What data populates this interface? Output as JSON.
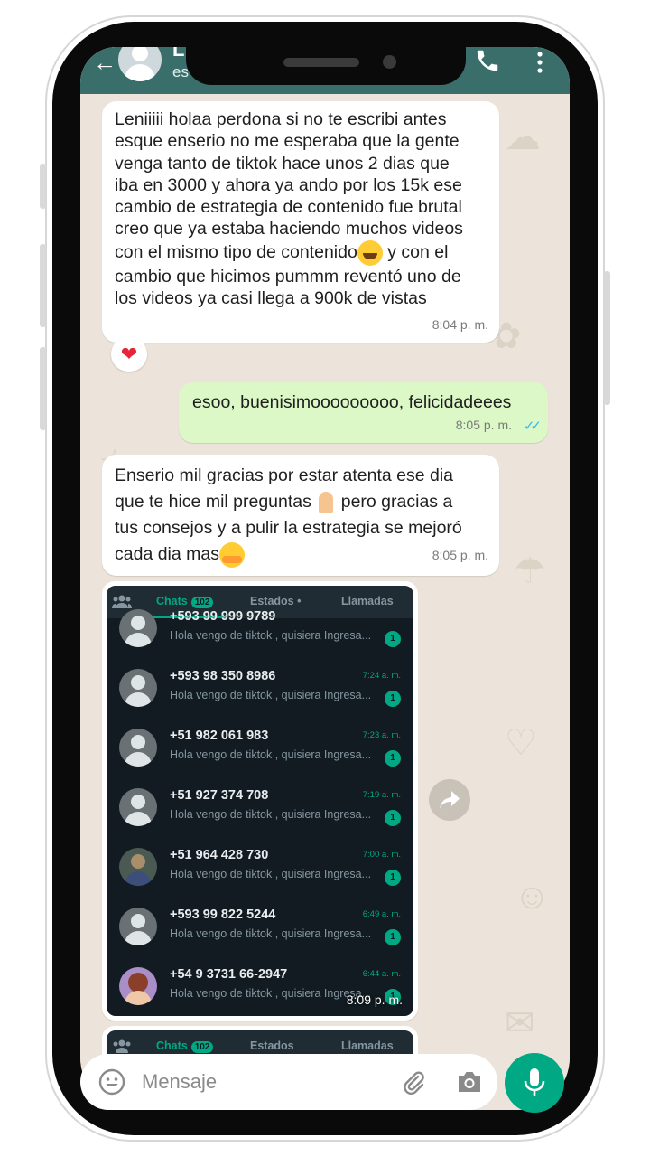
{
  "header": {
    "contact_name": "L",
    "contact_status": "es"
  },
  "messages": [
    {
      "direction": "in",
      "text_a": "Leniiiii holaa perdona si no te escribi antes\nesque enserio no me esperaba que la gente\nvenga tanto de tiktok hace unos 2 dias que\niba en 3000 y ahora ya ando por los 15k ese\ncambio de estrategia de contenido fue brutal\ncreo que ya estaba haciendo muchos videos\ncon el mismo tipo de contenido",
      "text_b": " y con el\ncambio que hicimos pummm reventó uno de\nlos videos ya casi llega a 900k de vistas",
      "time": "8:04 p. m.",
      "reaction": "❤"
    },
    {
      "direction": "out",
      "text": "esoo, buenisimooooooooo, felicidadeees",
      "time": "8:05 p. m.",
      "read_ticks": "✓✓"
    },
    {
      "direction": "in",
      "text_a": "Enserio mil gracias por estar atenta ese dia\nque te hice mil preguntas ",
      "text_b": " pero gracias a\ntus consejos y a pulir la estrategia se mejoró\ncada dia mas",
      "time": "8:05 p. m."
    }
  ],
  "image_message": {
    "time": "8:09 p. m.",
    "screenshot": {
      "tabs": [
        "Chats",
        "Estados •",
        "Llamadas"
      ],
      "chats_badge": "102",
      "rows": [
        {
          "phone": "+593 99 999 9789",
          "preview": "Hola vengo de tiktok , quisiera Ingresa...",
          "time": "",
          "unread": "1",
          "avatar": "default"
        },
        {
          "phone": "+593 98 350 8986",
          "preview": "Hola vengo de tiktok , quisiera Ingresa...",
          "time": "7:24 a. m.",
          "unread": "1",
          "avatar": "default"
        },
        {
          "phone": "+51 982 061 983",
          "preview": "Hola vengo de tiktok , quisiera Ingresa...",
          "time": "7:23 a. m.",
          "unread": "1",
          "avatar": "default"
        },
        {
          "phone": "+51 927 374 708",
          "preview": "Hola vengo de tiktok , quisiera Ingresa...",
          "time": "7:19 a. m.",
          "unread": "1",
          "avatar": "default"
        },
        {
          "phone": "+51 964 428 730",
          "preview": "Hola vengo de tiktok , quisiera Ingresa...",
          "time": "7:00 a. m.",
          "unread": "1",
          "avatar": "photo"
        },
        {
          "phone": "+593 99 822 5244",
          "preview": "Hola vengo de tiktok , quisiera Ingresa...",
          "time": "6:49 a. m.",
          "unread": "1",
          "avatar": "default"
        },
        {
          "phone": "+54 9 3731 66-2947",
          "preview": "Hola vengo de tiktok , quisiera Ingresa...",
          "time": "6:44 a. m.",
          "unread": "1",
          "avatar": "memoji"
        }
      ]
    }
  },
  "second_image_message": {
    "tabs": [
      "Chats",
      "Estados",
      "Llamadas"
    ],
    "chats_badge": "102"
  },
  "composer": {
    "placeholder": "Mensaje"
  },
  "colors": {
    "header": "#3a6e6b",
    "outgoing_bubble": "#dcf8c6",
    "accent": "#00a884",
    "read_ticks": "#34b7f1"
  }
}
